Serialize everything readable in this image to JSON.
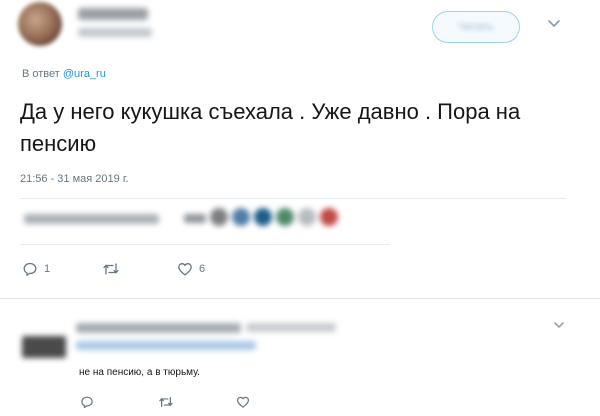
{
  "tweet": {
    "reply_prefix": "В ответ ",
    "reply_handle": "@ura_ru",
    "text": "Да у него кукушка съехала . Уже давно . Пора на пенсию",
    "timestamp": "21:56 - 31 мая 2019 г.",
    "actions": {
      "reply_count": "1",
      "retweet_count": "",
      "like_count": "6"
    }
  },
  "reply": {
    "text": "не на пенсию, а в тюрьму."
  },
  "colors": {
    "accent": "#1b95e0",
    "text": "#14171a",
    "muted": "#657786",
    "divider": "#e6ecf0"
  },
  "icons": {
    "reply": "speech-bubble",
    "retweet": "retweet-arrows",
    "like": "heart",
    "more": "chevron-down"
  }
}
